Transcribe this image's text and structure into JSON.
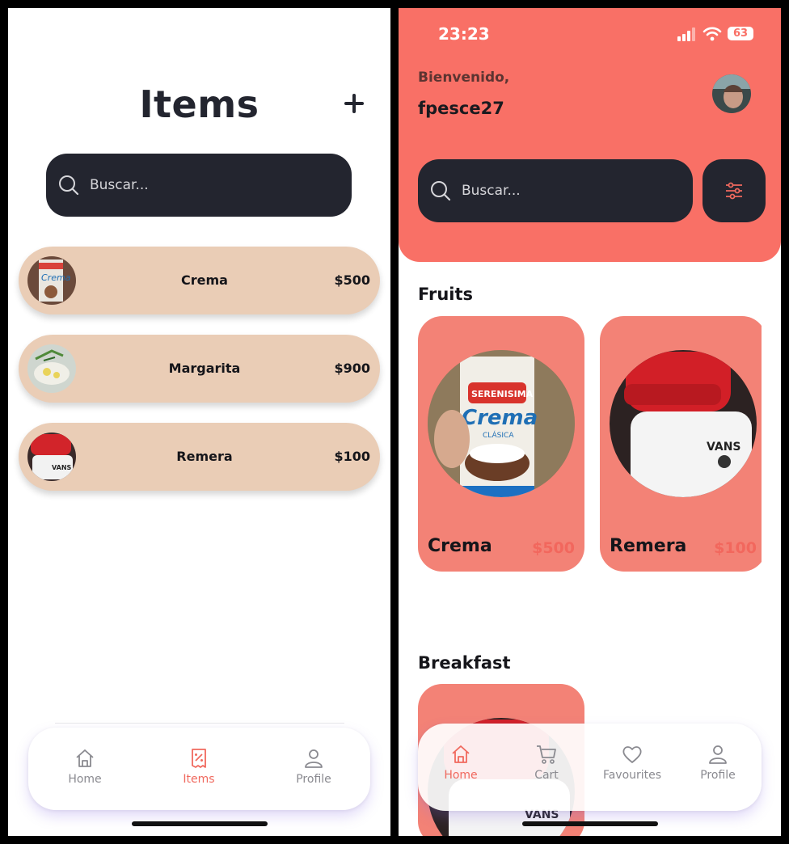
{
  "colors": {
    "accent": "#f0695e",
    "hero": "#f97066",
    "card": "#f38276",
    "rowBg": "#eacdb6",
    "dark": "#23252f"
  },
  "screen1": {
    "title": "Items",
    "add_icon": "plus-icon",
    "search": {
      "placeholder": "Buscar..."
    },
    "items": [
      {
        "name": "Crema",
        "price": "$500"
      },
      {
        "name": "Margarita",
        "price": "$900"
      },
      {
        "name": "Remera",
        "price": "$100"
      }
    ],
    "tabs": [
      {
        "label": "Home",
        "icon": "home-icon"
      },
      {
        "label": "Items",
        "icon": "receipt-icon",
        "active": true
      },
      {
        "label": "Profile",
        "icon": "user-icon"
      }
    ]
  },
  "screen2": {
    "status": {
      "time": "23:23",
      "battery": "63"
    },
    "greeting": "Bienvenido,",
    "username": "fpesce27",
    "search": {
      "placeholder": "Buscar..."
    },
    "sections": [
      {
        "title": "Fruits",
        "cards": [
          {
            "name": "Crema",
            "price": "$500"
          },
          {
            "name": "Remera",
            "price": "$100"
          }
        ]
      },
      {
        "title": "Breakfast"
      }
    ],
    "tabs": [
      {
        "label": "Home",
        "icon": "home-icon",
        "active": true
      },
      {
        "label": "Cart",
        "icon": "cart-icon"
      },
      {
        "label": "Favourites",
        "icon": "heart-icon"
      },
      {
        "label": "Profile",
        "icon": "user-icon"
      }
    ]
  }
}
